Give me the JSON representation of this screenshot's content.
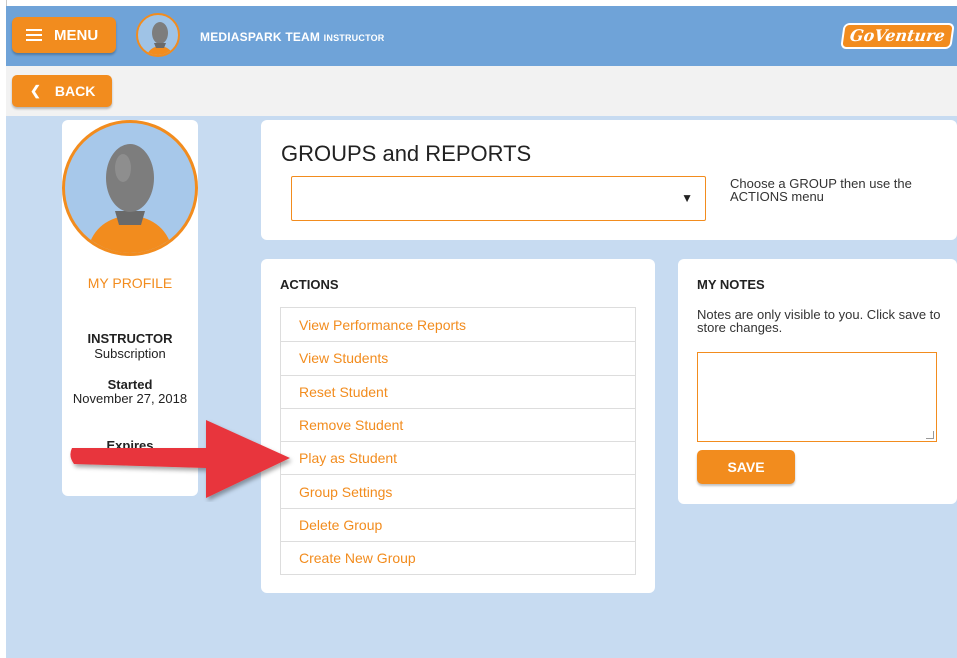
{
  "header": {
    "menu_label": "MENU",
    "team_name": "MEDIASPARK TEAM",
    "team_role": "INSTRUCTOR",
    "logo_text": "GoVenture",
    "accent_color": "#f28c1e",
    "bar_color": "#6fa3d8"
  },
  "subbar": {
    "back_label": "BACK"
  },
  "profile": {
    "link_label": "MY PROFILE",
    "role": "INSTRUCTOR",
    "subscription": "Subscription",
    "started_label": "Started",
    "started_date": "November 27, 2018",
    "expires_label": "Expires"
  },
  "groups": {
    "title": "GROUPS and REPORTS",
    "select_value": "",
    "hint": "Choose a GROUP then use the ACTIONS menu"
  },
  "actions": {
    "title": "ACTIONS",
    "items": [
      "View Performance Reports",
      "View Students",
      "Reset Student",
      "Remove Student",
      "Play as Student",
      "Group Settings",
      "Delete Group",
      "Create New Group"
    ]
  },
  "notes": {
    "title": "MY NOTES",
    "hint": "Notes are only visible to you. Click save to store changes.",
    "value": "",
    "save_label": "SAVE"
  },
  "annotation": {
    "arrow_color": "#e8363c",
    "target_item": "Play as Student"
  }
}
